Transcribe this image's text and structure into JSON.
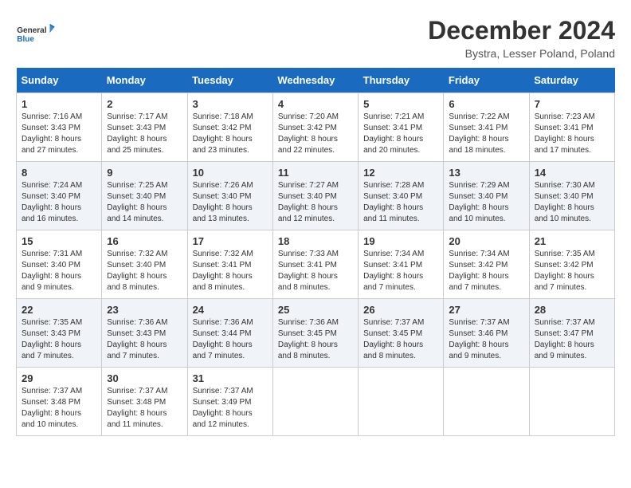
{
  "logo": {
    "line1": "General",
    "line2": "Blue"
  },
  "title": "December 2024",
  "location": "Bystra, Lesser Poland, Poland",
  "headers": [
    "Sunday",
    "Monday",
    "Tuesday",
    "Wednesday",
    "Thursday",
    "Friday",
    "Saturday"
  ],
  "weeks": [
    [
      {
        "day": "1",
        "info": "Sunrise: 7:16 AM\nSunset: 3:43 PM\nDaylight: 8 hours\nand 27 minutes."
      },
      {
        "day": "2",
        "info": "Sunrise: 7:17 AM\nSunset: 3:43 PM\nDaylight: 8 hours\nand 25 minutes."
      },
      {
        "day": "3",
        "info": "Sunrise: 7:18 AM\nSunset: 3:42 PM\nDaylight: 8 hours\nand 23 minutes."
      },
      {
        "day": "4",
        "info": "Sunrise: 7:20 AM\nSunset: 3:42 PM\nDaylight: 8 hours\nand 22 minutes."
      },
      {
        "day": "5",
        "info": "Sunrise: 7:21 AM\nSunset: 3:41 PM\nDaylight: 8 hours\nand 20 minutes."
      },
      {
        "day": "6",
        "info": "Sunrise: 7:22 AM\nSunset: 3:41 PM\nDaylight: 8 hours\nand 18 minutes."
      },
      {
        "day": "7",
        "info": "Sunrise: 7:23 AM\nSunset: 3:41 PM\nDaylight: 8 hours\nand 17 minutes."
      }
    ],
    [
      {
        "day": "8",
        "info": "Sunrise: 7:24 AM\nSunset: 3:40 PM\nDaylight: 8 hours\nand 16 minutes."
      },
      {
        "day": "9",
        "info": "Sunrise: 7:25 AM\nSunset: 3:40 PM\nDaylight: 8 hours\nand 14 minutes."
      },
      {
        "day": "10",
        "info": "Sunrise: 7:26 AM\nSunset: 3:40 PM\nDaylight: 8 hours\nand 13 minutes."
      },
      {
        "day": "11",
        "info": "Sunrise: 7:27 AM\nSunset: 3:40 PM\nDaylight: 8 hours\nand 12 minutes."
      },
      {
        "day": "12",
        "info": "Sunrise: 7:28 AM\nSunset: 3:40 PM\nDaylight: 8 hours\nand 11 minutes."
      },
      {
        "day": "13",
        "info": "Sunrise: 7:29 AM\nSunset: 3:40 PM\nDaylight: 8 hours\nand 10 minutes."
      },
      {
        "day": "14",
        "info": "Sunrise: 7:30 AM\nSunset: 3:40 PM\nDaylight: 8 hours\nand 10 minutes."
      }
    ],
    [
      {
        "day": "15",
        "info": "Sunrise: 7:31 AM\nSunset: 3:40 PM\nDaylight: 8 hours\nand 9 minutes."
      },
      {
        "day": "16",
        "info": "Sunrise: 7:32 AM\nSunset: 3:40 PM\nDaylight: 8 hours\nand 8 minutes."
      },
      {
        "day": "17",
        "info": "Sunrise: 7:32 AM\nSunset: 3:41 PM\nDaylight: 8 hours\nand 8 minutes."
      },
      {
        "day": "18",
        "info": "Sunrise: 7:33 AM\nSunset: 3:41 PM\nDaylight: 8 hours\nand 8 minutes."
      },
      {
        "day": "19",
        "info": "Sunrise: 7:34 AM\nSunset: 3:41 PM\nDaylight: 8 hours\nand 7 minutes."
      },
      {
        "day": "20",
        "info": "Sunrise: 7:34 AM\nSunset: 3:42 PM\nDaylight: 8 hours\nand 7 minutes."
      },
      {
        "day": "21",
        "info": "Sunrise: 7:35 AM\nSunset: 3:42 PM\nDaylight: 8 hours\nand 7 minutes."
      }
    ],
    [
      {
        "day": "22",
        "info": "Sunrise: 7:35 AM\nSunset: 3:43 PM\nDaylight: 8 hours\nand 7 minutes."
      },
      {
        "day": "23",
        "info": "Sunrise: 7:36 AM\nSunset: 3:43 PM\nDaylight: 8 hours\nand 7 minutes."
      },
      {
        "day": "24",
        "info": "Sunrise: 7:36 AM\nSunset: 3:44 PM\nDaylight: 8 hours\nand 7 minutes."
      },
      {
        "day": "25",
        "info": "Sunrise: 7:36 AM\nSunset: 3:45 PM\nDaylight: 8 hours\nand 8 minutes."
      },
      {
        "day": "26",
        "info": "Sunrise: 7:37 AM\nSunset: 3:45 PM\nDaylight: 8 hours\nand 8 minutes."
      },
      {
        "day": "27",
        "info": "Sunrise: 7:37 AM\nSunset: 3:46 PM\nDaylight: 8 hours\nand 9 minutes."
      },
      {
        "day": "28",
        "info": "Sunrise: 7:37 AM\nSunset: 3:47 PM\nDaylight: 8 hours\nand 9 minutes."
      }
    ],
    [
      {
        "day": "29",
        "info": "Sunrise: 7:37 AM\nSunset: 3:48 PM\nDaylight: 8 hours\nand 10 minutes."
      },
      {
        "day": "30",
        "info": "Sunrise: 7:37 AM\nSunset: 3:48 PM\nDaylight: 8 hours\nand 11 minutes."
      },
      {
        "day": "31",
        "info": "Sunrise: 7:37 AM\nSunset: 3:49 PM\nDaylight: 8 hours\nand 12 minutes."
      },
      null,
      null,
      null,
      null
    ]
  ]
}
